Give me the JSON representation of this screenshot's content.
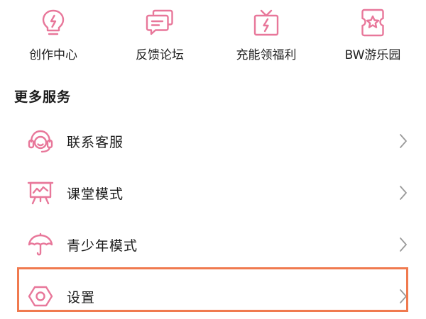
{
  "shortcuts": [
    {
      "label": "创作中心",
      "icon": "lightbulb-icon"
    },
    {
      "label": "反馈论坛",
      "icon": "chat-bubbles-icon"
    },
    {
      "label": "充能领福利",
      "icon": "gift-bolt-icon"
    },
    {
      "label": "BW游乐园",
      "icon": "star-ticket-icon"
    }
  ],
  "more_services": {
    "title": "更多服务",
    "items": [
      {
        "label": "联系客服",
        "icon": "headset-icon"
      },
      {
        "label": "课堂模式",
        "icon": "presentation-board-icon"
      },
      {
        "label": "青少年模式",
        "icon": "umbrella-icon"
      },
      {
        "label": "设置",
        "icon": "settings-hexagon-icon",
        "highlighted": true
      }
    ]
  },
  "colors": {
    "icon_pink": "#e8779a",
    "text": "#1a1a1a",
    "chevron": "#9a9a9a",
    "highlight": "#f07a4f",
    "background": "#ffffff"
  }
}
